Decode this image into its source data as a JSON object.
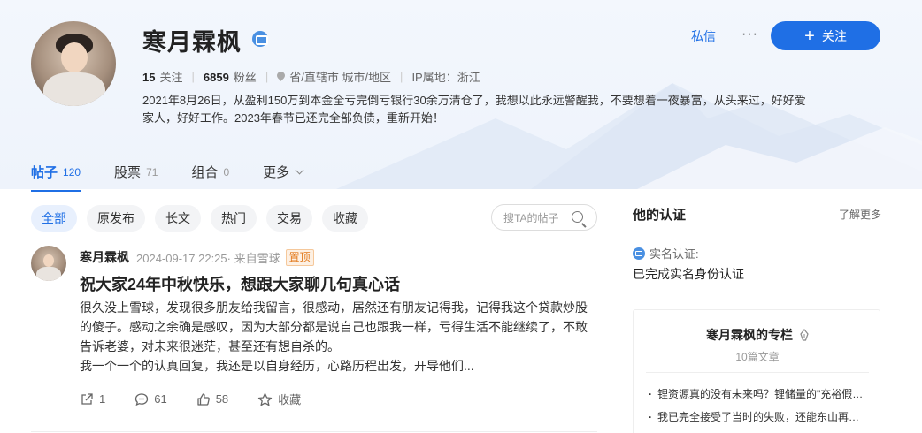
{
  "profile": {
    "name": "寒月霖枫",
    "following_count": "15",
    "following_label": "关注",
    "followers_count": "6859",
    "followers_label": "粉丝",
    "location": "省/直辖市 城市/地区",
    "ip_location": "IP属地：浙江",
    "bio": "2021年8月26日，从盈利150万到本金全亏完倒亏银行30余万清仓了，我想以此永远警醒我，不要想着一夜暴富，从头来过，好好爱家人，好好工作。2023年春节已还完全部负债，重新开始！"
  },
  "header_actions": {
    "message_label": "私信",
    "more_label": "···",
    "follow_label": "关注"
  },
  "tabs": [
    {
      "label": "帖子",
      "count": "120"
    },
    {
      "label": "股票",
      "count": "71"
    },
    {
      "label": "组合",
      "count": "0"
    },
    {
      "label": "更多",
      "count": ""
    }
  ],
  "filters": [
    "全部",
    "原发布",
    "长文",
    "热门",
    "交易",
    "收藏"
  ],
  "search": {
    "placeholder": "搜TA的帖子"
  },
  "post": {
    "author": "寒月霖枫",
    "time": "2024-09-17 22:25· 来自雪球",
    "pin_label": "置顶",
    "title": "祝大家24年中秋快乐，想跟大家聊几句真心话",
    "body_line1": "很久没上雪球，发现很多朋友给我留言，很感动，居然还有朋友记得我，记得我这个贷款炒股的傻子。感动之余确是感叹，因为大部分都是说自己也跟我一样，亏得生活不能继续了，不敢告诉老婆，对未来很迷茫，甚至还有想自杀的。",
    "body_line2": "我一个一个的认真回复，我还是以自身经历，心路历程出发，开导他们...",
    "share_count": "1",
    "comment_count": "61",
    "like_count": "58",
    "favorite_label": "收藏"
  },
  "sidebar": {
    "cert_title": "他的认证",
    "cert_more": "了解更多",
    "cert_label": "实名认证:",
    "cert_value": "已完成实名身份认证",
    "column_title": "寒月霖枫的专栏",
    "column_count": "10篇文章",
    "column_items": [
      "锂资源真的没有未来吗？锂储量的\"充裕假…",
      "我已完全接受了当时的失败，还能东山再…"
    ]
  },
  "colors": {
    "accent": "#1f6fe5",
    "pin": "#e2791b"
  }
}
